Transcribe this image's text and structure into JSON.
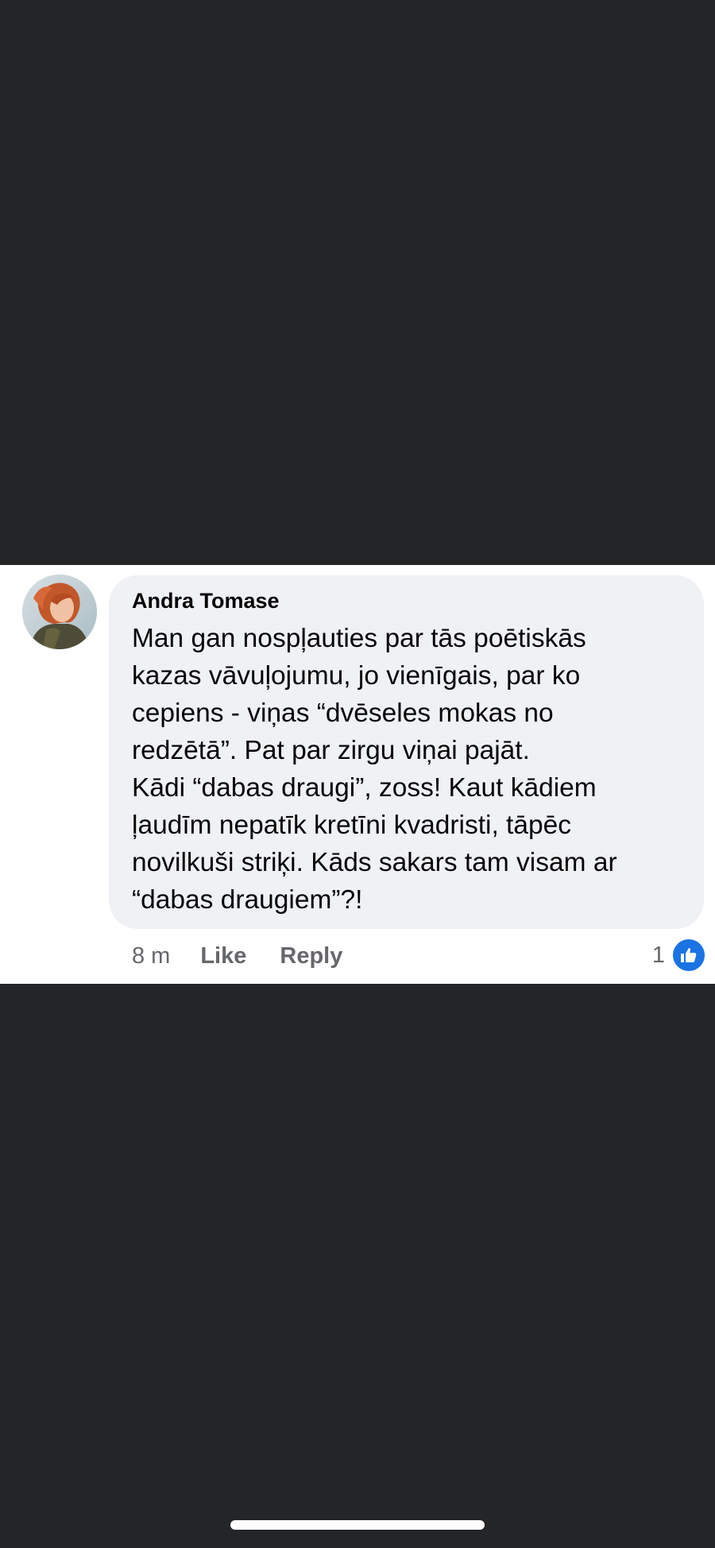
{
  "comment": {
    "author": "Andra Tomase",
    "lines": [
      "Man gan nospļauties par tās poētiskās",
      "kazas vāvuļojumu, jo vienīgais, par ko",
      "cepiens - viņas “dvēseles mokas no",
      "redzētā”. Pat par zirgu viņai pajāt.",
      "Kādi “dabas draugi”, zoss! Kaut kādiem",
      "ļaudīm nepatīk kretīni kvadristi, tāpēc",
      "novilkuši striķi. Kāds sakars tam visam ar",
      "“dabas draugiem”?!"
    ],
    "time": "8 m",
    "like_label": "Like",
    "reply_label": "Reply",
    "reaction_count": "1",
    "reaction_icon": "thumbs-up-icon"
  },
  "colors": {
    "background": "#242527",
    "bubble": "#eff1f4",
    "like_blue": "#1b74e4",
    "meta_gray": "#65676b"
  }
}
